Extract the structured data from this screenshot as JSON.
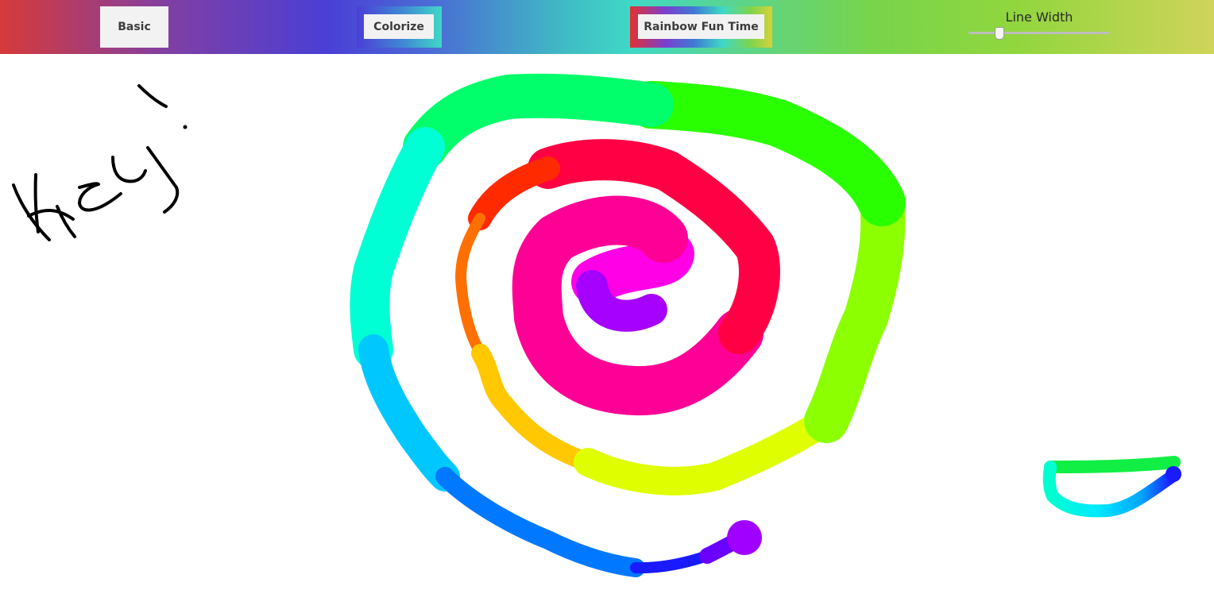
{
  "toolbar": {
    "basic_label": "Basic",
    "colorize_label": "Colorize",
    "rainbow_label": "Rainbow Fun Time",
    "line_width_label": "Line Width",
    "line_width_value": 0.2
  },
  "canvas": {
    "strokes": [
      "hey-text",
      "rainbow-spiral",
      "smiley-eyes",
      "smiley-mouth"
    ]
  }
}
